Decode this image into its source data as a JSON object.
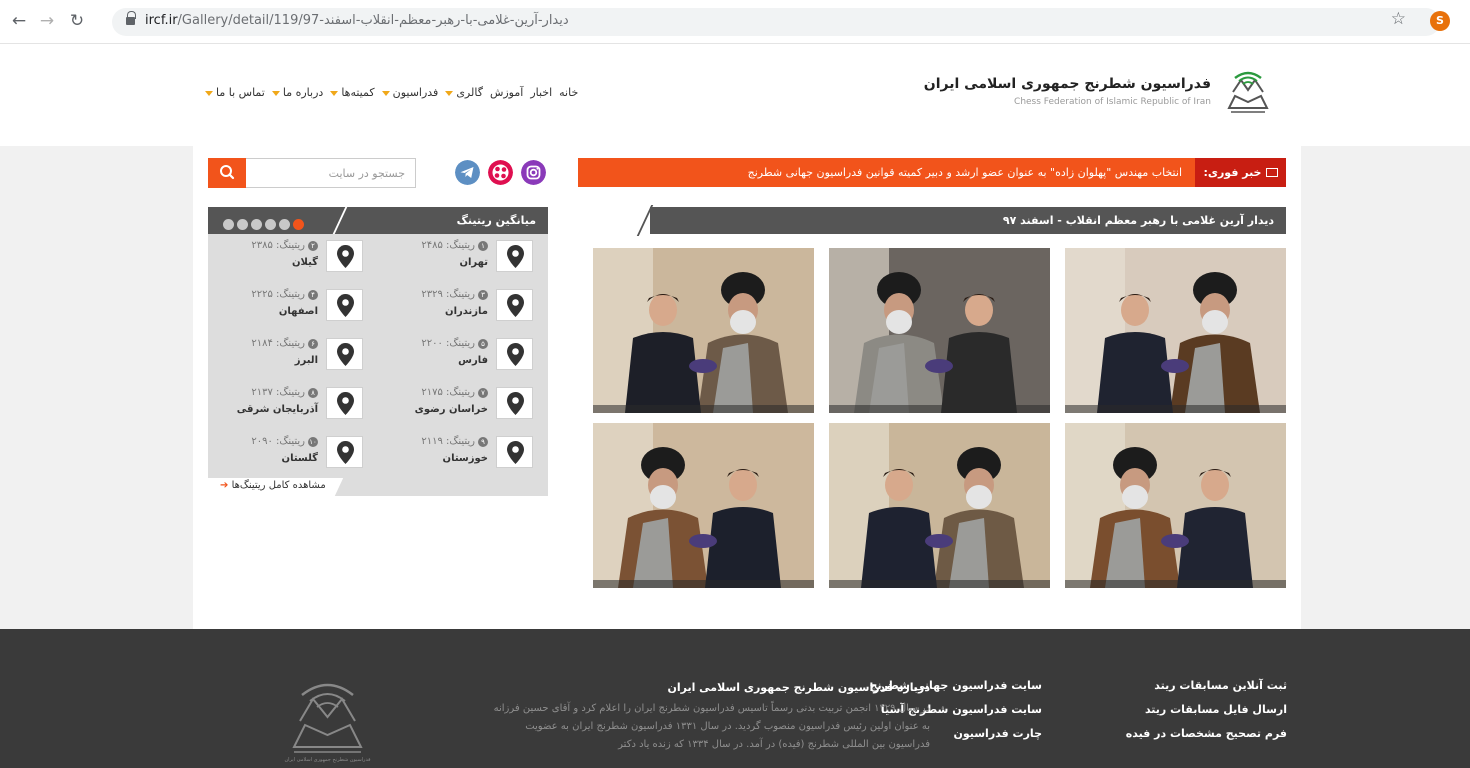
{
  "browser": {
    "url_host": "ircf.ir",
    "url_path": "/Gallery/detail/119/97-دیدار-آرین-غلامی-با-رهبر-معظم-انقلاب-اسفند",
    "profile_initial": "S"
  },
  "site": {
    "title": "فدراسیون شطرنج جمهوری اسلامی ایران",
    "subtitle": "Chess Federation of Islamic Republic of Iran"
  },
  "menu": [
    {
      "label": "خانه",
      "dropdown": false
    },
    {
      "label": "اخبار",
      "dropdown": false
    },
    {
      "label": "آموزش",
      "dropdown": false
    },
    {
      "label": "گالری",
      "dropdown": true
    },
    {
      "label": "فدراسیون",
      "dropdown": true
    },
    {
      "label": "کمیته‌ها",
      "dropdown": true
    },
    {
      "label": "درباره ما",
      "dropdown": true
    },
    {
      "label": "تماس با ما",
      "dropdown": true
    }
  ],
  "news": {
    "label": "خبر فوری:",
    "text": "انتخاب مهندس \"پهلوان زاده\" به عنوان عضو ارشد و دبیر کمیته قوانین فدراسیون جهانی شطرنج"
  },
  "gallery": {
    "title": "دیدار آرین غلامی با رهبر معظم انقلاب - اسفند ۹۷",
    "photo_count": 6
  },
  "search": {
    "placeholder": "جستجو در سایت"
  },
  "social": [
    "instagram-icon",
    "aparat-icon",
    "telegram-icon"
  ],
  "rating": {
    "title": "میانگین ریتینگ",
    "page_count": 6,
    "active_page": 6,
    "items": [
      {
        "rank": "۱",
        "rating": "ریتینگ: ۲۴۸۵",
        "province": "تهران"
      },
      {
        "rank": "۲",
        "rating": "ریتینگ: ۲۳۸۵",
        "province": "گیلان"
      },
      {
        "rank": "۳",
        "rating": "ریتینگ: ۲۳۲۹",
        "province": "مازندران"
      },
      {
        "rank": "۴",
        "rating": "ریتینگ: ۲۲۲۵",
        "province": "اصفهان"
      },
      {
        "rank": "۵",
        "rating": "ریتینگ: ۲۲۰۰",
        "province": "فارس"
      },
      {
        "rank": "۶",
        "rating": "ریتینگ: ۲۱۸۴",
        "province": "البرز"
      },
      {
        "rank": "۷",
        "rating": "ریتینگ: ۲۱۷۵",
        "province": "خراسان رضوی"
      },
      {
        "rank": "۸",
        "rating": "ریتینگ: ۲۱۳۷",
        "province": "آذربایجان شرقی"
      },
      {
        "rank": "۹",
        "rating": "ریتینگ: ۲۱۱۹",
        "province": "خوزستان"
      },
      {
        "rank": "۱۰",
        "rating": "ریتینگ: ۲۰۹۰",
        "province": "گلستان"
      }
    ],
    "more": "مشاهده کامل ریتینگ‌ها"
  },
  "footer": {
    "col1": [
      "ثبت آنلاین مسابقات ریتد",
      "ارسال فایل مسابقات ریتد",
      "فرم تصحیح مشخصات در فیده"
    ],
    "col2": [
      "سایت فدراسیون جهانی شطرنج",
      "سایت فدراسیون شطرنج آسیا",
      "چارت فدراسیون"
    ],
    "about_title": "درباره فدراسیون شطرنج جمهوری اسلامی ایران",
    "about_text": "در سال ۱۳۲۹ انجمن تربیت بدنی رسماً تاسیس فدراسیون شطرنج ایران را اعلام کرد و آقای حسین فرزانه به عنوان اولین رئیس فدراسیون منصوب گردید. در سال ۱۳۳۱ فدراسیون شطرنج ایران به عضویت فدراسیون بین المللی شطرنج (فیده) در آمد. در سال ۱۳۳۴ که زنده یاد دکتر",
    "logo_caption": "فدراسیون شطرنج جمهوری اسلامی ایران"
  },
  "colors": {
    "accent": "#f2541b",
    "breaking": "#c81e12",
    "header_bar": "#555555",
    "footer_bg": "#3a3a3a",
    "menu_caret": "#f0a81a"
  }
}
